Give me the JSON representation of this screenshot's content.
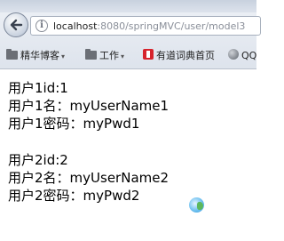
{
  "browser": {
    "url": {
      "host": "localhost",
      "rest": ":8080/springMVC/user/model3"
    },
    "bookmarks": [
      {
        "label": "精华博客",
        "icon": "folder-icon"
      },
      {
        "label": "工作",
        "icon": "folder-icon"
      },
      {
        "label": "有道词典首页",
        "icon": "youdao-icon"
      },
      {
        "label": "QQ",
        "icon": "globe-icon"
      }
    ]
  },
  "content": {
    "user1": {
      "id": "用户1id:1",
      "name": "用户1名：myUserName1",
      "pwd": "用户1密码：myPwd1"
    },
    "user2": {
      "id": "用户2id:2",
      "name": "用户2名：myUserName2",
      "pwd": "用户2密码：myPwd2"
    }
  }
}
